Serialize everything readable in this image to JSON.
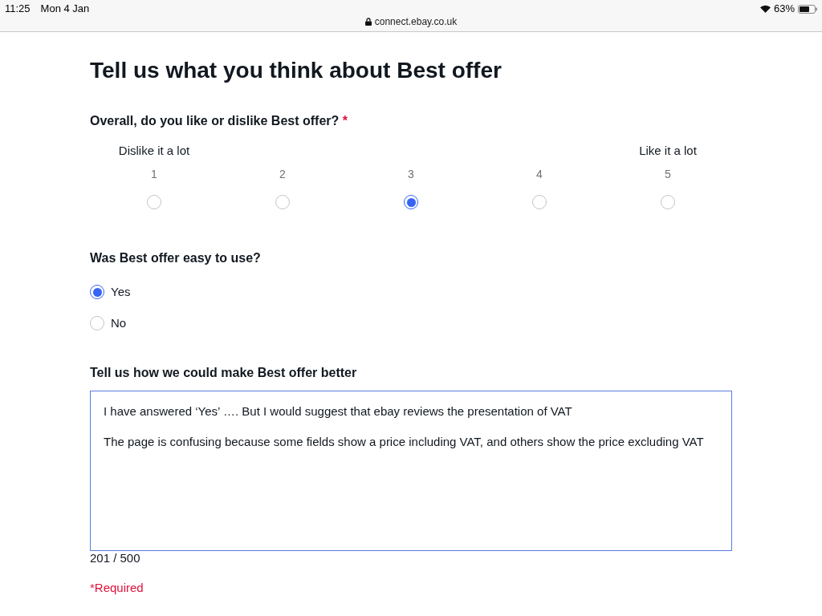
{
  "status_bar": {
    "time": "11:25",
    "date": "Mon 4 Jan",
    "url": "connect.ebay.co.uk",
    "battery": "63%"
  },
  "page": {
    "title": "Tell us what you think about Best offer"
  },
  "questions": [
    {
      "kind": "scale",
      "label": "Overall, do you like or dislike Best offer?",
      "required_mark": "*",
      "low_label": "Dislike it a lot",
      "high_label": "Like it a lot",
      "options": [
        {
          "label": "1",
          "selected": false
        },
        {
          "label": "2",
          "selected": false
        },
        {
          "label": "3",
          "selected": true
        },
        {
          "label": "4",
          "selected": false
        },
        {
          "label": "5",
          "selected": false
        }
      ]
    },
    {
      "kind": "choice",
      "label": "Was Best offer easy to use?",
      "options": [
        {
          "label": "Yes",
          "selected": true
        },
        {
          "label": "No",
          "selected": false
        }
      ]
    },
    {
      "kind": "text",
      "label": "Tell us how we could make Best offer better",
      "value": [
        "I have answered ‘Yes’ …. But I would suggest that ebay reviews the presentation of VAT",
        "The page is confusing because some fields show a price including VAT, and others show the price excluding VAT"
      ],
      "counter": "201 / 500"
    }
  ],
  "required_note": "*Required"
}
